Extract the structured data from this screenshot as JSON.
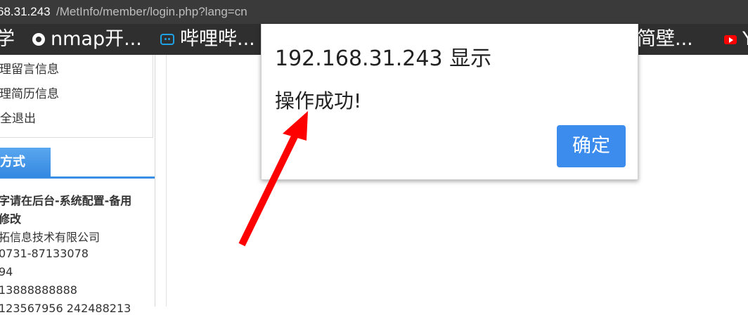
{
  "address_bar": {
    "host": "68.31.243",
    "path": "/MetInfo/member/login.php?lang=cn"
  },
  "bookmarks": [
    {
      "label": "学",
      "icon": "none"
    },
    {
      "label": "nmap开...",
      "icon": "globe-icon"
    },
    {
      "label": "哔哩哔...",
      "icon": "bilibili-icon"
    },
    {
      "label": "简壁...",
      "icon": "none"
    },
    {
      "label": "Y",
      "icon": "youtube-icon"
    }
  ],
  "sidebar": {
    "menu_items": [
      "理留言信息",
      "理简历信息",
      "安全退出"
    ],
    "tab_label": "联系方式",
    "contact_lines": [
      "字请在后台-系统配置-备用",
      "修改",
      "拓信息技术有限公司",
      "0731-87133078",
      "94",
      "13888888888",
      "123567956 242488213"
    ]
  },
  "dialog": {
    "title": "192.168.31.243 显示",
    "message": "操作成功!",
    "ok_label": "确定"
  },
  "colors": {
    "button_blue": "#3b8ced",
    "tab_blue": "#3a8ee6",
    "annotation_arrow": "#ff0000"
  }
}
